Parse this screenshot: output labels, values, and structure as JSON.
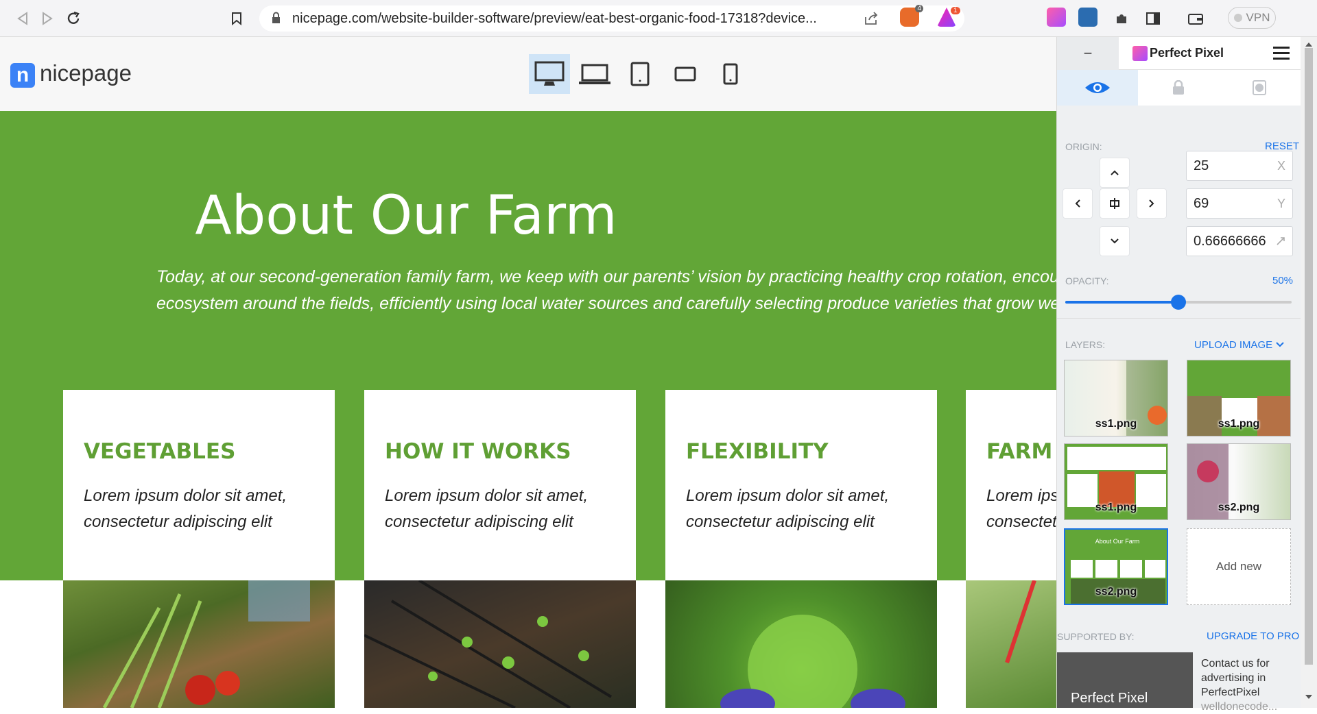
{
  "browser": {
    "url": "nicepage.com/website-builder-software/preview/eat-best-organic-food-17318?device...",
    "vpn_label": "VPN",
    "brave_badge": "4",
    "alert_badge": "1"
  },
  "site": {
    "logo_text": "nicepage",
    "logo_letter": "n",
    "devices": [
      "desktop-icon",
      "laptop-icon",
      "tablet-icon",
      "tablet-landscape-icon",
      "phone-icon"
    ]
  },
  "hero": {
    "title": "About Our Farm",
    "text_line1": "Today, at our second-generation family farm, we keep with our parents’ vision by practicing healthy crop rotation, encouraging a vibrant",
    "text_line2": "ecosystem around the fields, efficiently using local water sources and carefully selecting produce varieties that grow well and taste great."
  },
  "cards": [
    {
      "title": "VEGETABLES",
      "line1": "Lorem ipsum dolor sit amet,",
      "line2": "consectetur adipiscing elit"
    },
    {
      "title": "HOW IT WORKS",
      "line1": "Lorem ipsum dolor sit amet,",
      "line2": "consectetur adipiscing elit"
    },
    {
      "title": "FLEXIBILITY",
      "line1": "Lorem ipsum dolor sit amet,",
      "line2": "consectetur adipiscing elit"
    },
    {
      "title": "FARM PRODUCTS",
      "line1": "Lorem ipsum dolor sit amet,",
      "line2": "consectetur adipiscing elit"
    }
  ],
  "perfect_pixel": {
    "title": "Perfect Pixel",
    "minimize": "−",
    "origin_label": "ORIGIN:",
    "reset_label": "RESET",
    "x_value": "25",
    "x_suffix": "X",
    "y_value": "69",
    "y_suffix": "Y",
    "scale_value": "0.66666666",
    "opacity_label": "OPACITY:",
    "opacity_value": "50%",
    "opacity_fraction": 0.5,
    "layers_label": "LAYERS:",
    "upload_label": "UPLOAD IMAGE",
    "layers": [
      {
        "name": "ss1.png"
      },
      {
        "name": "ss1.png"
      },
      {
        "name": "ss1.png"
      },
      {
        "name": "ss2.png"
      },
      {
        "name": "ss2.png",
        "thumb_title": "About Our Farm"
      }
    ],
    "add_new": "Add new",
    "supported_by": "SUPPORTED BY:",
    "upgrade": "UPGRADE TO PRO",
    "ad_text": "Contact us for advertising in PerfectPixel",
    "ad_text2": "welldonecode...",
    "ad_brand": "Perfect Pixel",
    "accent": "#1a73e8"
  },
  "colors": {
    "hero_green": "#62a637",
    "card_title_green": "#5f9f34"
  }
}
